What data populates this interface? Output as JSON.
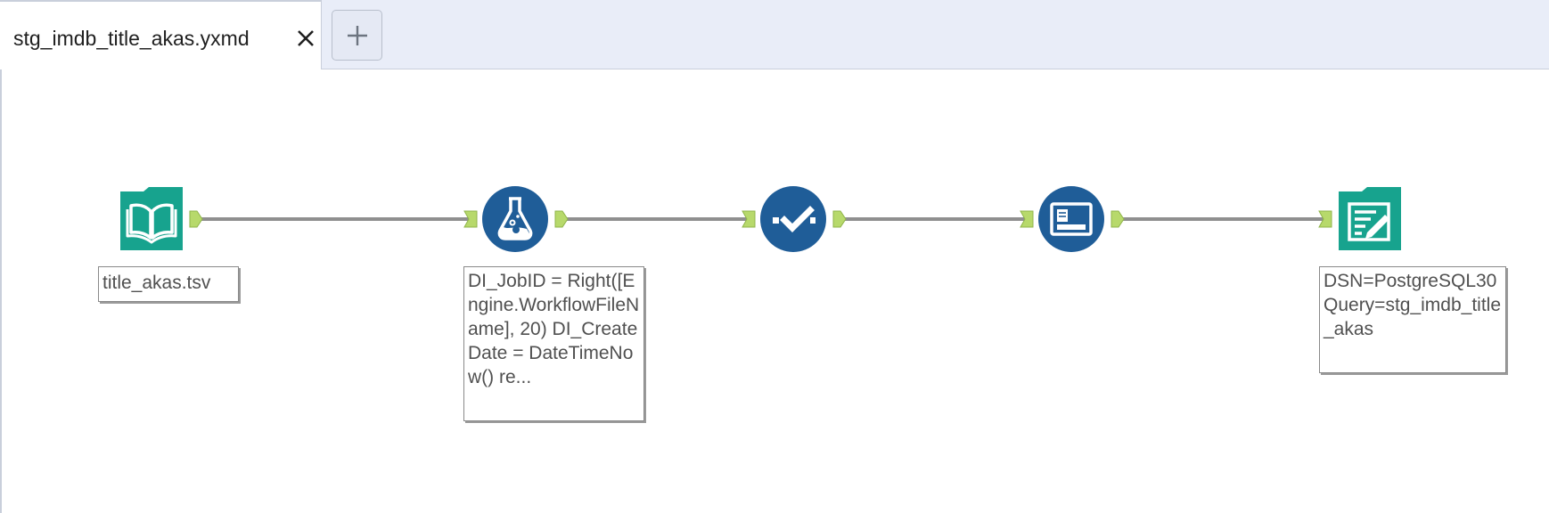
{
  "tab": {
    "title": "stg_imdb_title_akas.yxmd",
    "close_icon": "close-icon",
    "add_icon": "plus-icon"
  },
  "workflow": {
    "tools": [
      {
        "name": "input-data-tool",
        "icon": "open-book-icon",
        "color": "#17a38e"
      },
      {
        "name": "formula-tool",
        "icon": "flask-icon",
        "color": "#1f5d98"
      },
      {
        "name": "select-tool",
        "icon": "checkmark-icon",
        "color": "#1f5d98"
      },
      {
        "name": "dynamic-input-tool",
        "icon": "window-icon",
        "color": "#1f5d98"
      },
      {
        "name": "output-data-tool",
        "icon": "pen-document-icon",
        "color": "#17a38e"
      }
    ],
    "annotations": {
      "input": "title_akas.tsv",
      "formula": "DI_JobID = Right([Engine.WorkflowFileName], 20) DI_CreateDate = DateTimeNow() re...",
      "output": "DSN=PostgreSQL30 Query=stg_imdb_title_akas"
    },
    "colors": {
      "anchor": "#b7d96b",
      "connector": "#8f8f8f",
      "teal": "#17a38e",
      "blue": "#1f5d98"
    }
  }
}
